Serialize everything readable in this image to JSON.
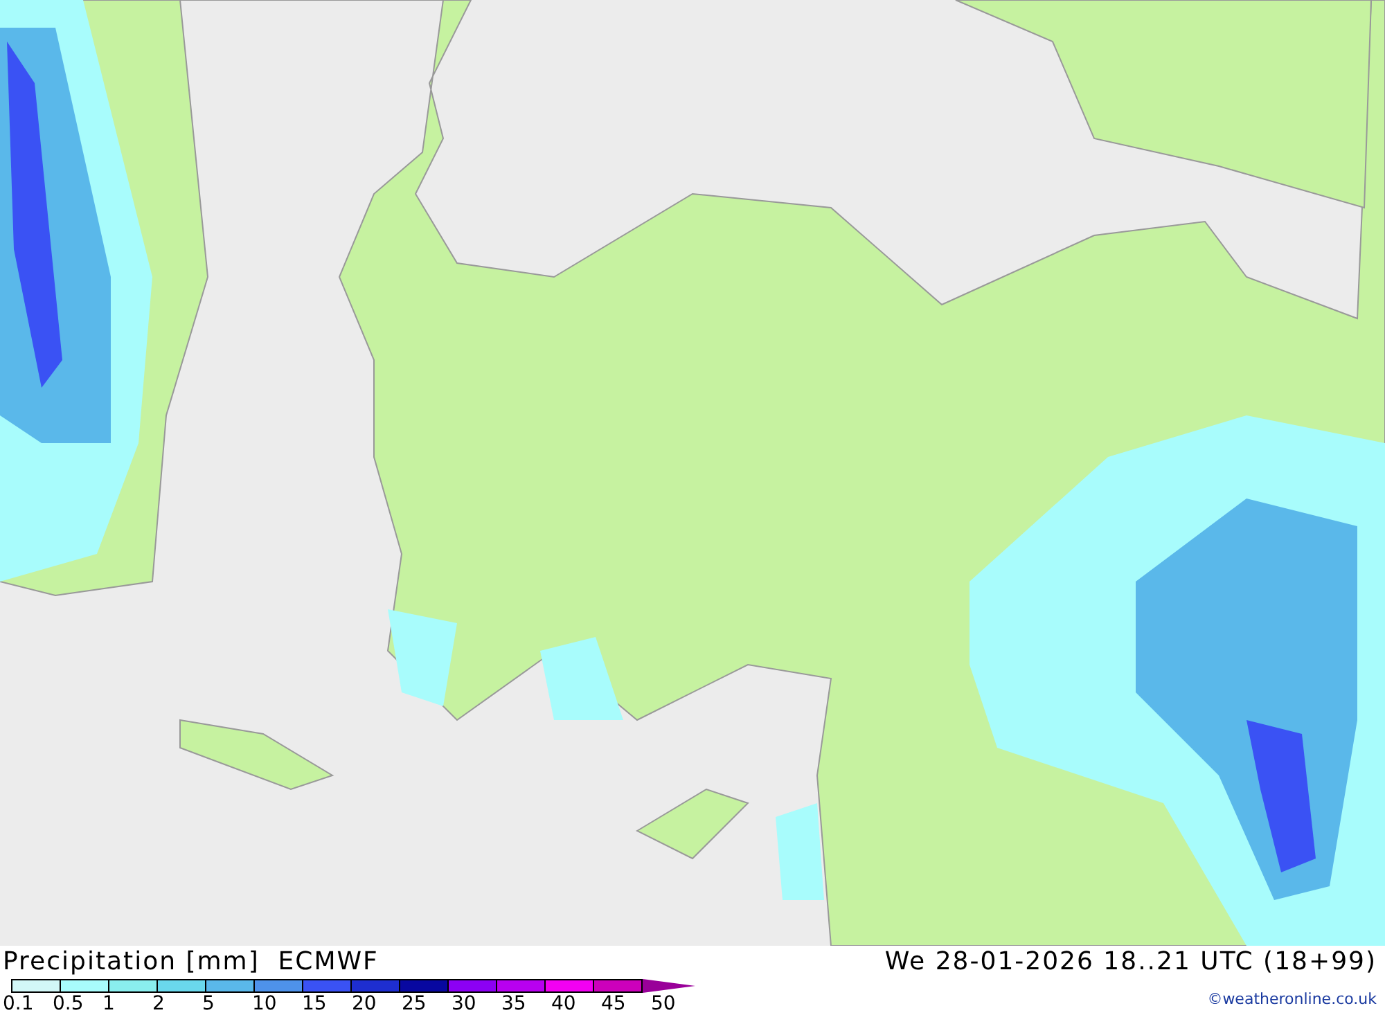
{
  "title": "Precipitation [mm]  ECMWF",
  "valid_time": "We 28-01-2026 18..21 UTC (18+99)",
  "legend": {
    "bins": [
      {
        "color": "#d2f7f7"
      },
      {
        "color": "#a8fcfc"
      },
      {
        "color": "#8aeeee"
      },
      {
        "color": "#6ad8ec"
      },
      {
        "color": "#5ab8ea"
      },
      {
        "color": "#4e92ea"
      },
      {
        "color": "#3a52f4"
      },
      {
        "color": "#1e2ed0"
      },
      {
        "color": "#0808a0"
      },
      {
        "color": "#8c00f4"
      },
      {
        "color": "#b800f0"
      },
      {
        "color": "#f200f2"
      },
      {
        "color": "#cc00bb"
      }
    ],
    "overflow": {
      "color": "#990099"
    },
    "labels": [
      "0.1",
      "0.5",
      "1",
      "2",
      "5",
      "10",
      "15",
      "20",
      "25",
      "30",
      "35",
      "40",
      "45",
      "50"
    ]
  },
  "credit": "©weatheronline.co.uk"
}
